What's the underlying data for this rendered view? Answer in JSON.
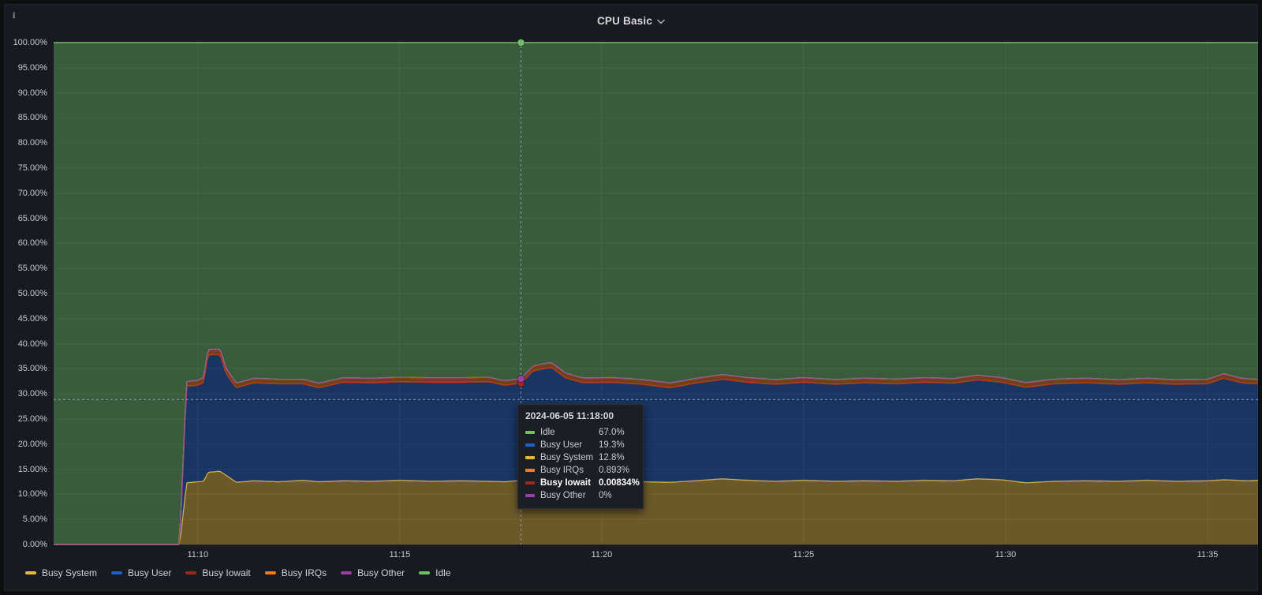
{
  "panel": {
    "title": "CPU Basic",
    "info_icon": "i"
  },
  "y_axis": {
    "ticks": [
      "100.00%",
      "95.00%",
      "90.00%",
      "85.00%",
      "80.00%",
      "75.00%",
      "70.00%",
      "65.00%",
      "60.00%",
      "55.00%",
      "50.00%",
      "45.00%",
      "40.00%",
      "35.00%",
      "30.00%",
      "25.00%",
      "20.00%",
      "15.00%",
      "10.00%",
      "5.00%",
      "0.00%"
    ]
  },
  "x_axis": {
    "ticks": [
      {
        "label": "11:10",
        "t": 10
      },
      {
        "label": "11:15",
        "t": 15
      },
      {
        "label": "11:20",
        "t": 20
      },
      {
        "label": "11:25",
        "t": 25
      },
      {
        "label": "11:30",
        "t": 30
      },
      {
        "label": "11:35",
        "t": 35
      }
    ]
  },
  "legend": {
    "items": [
      {
        "label": "Busy System",
        "color": "#EAB839"
      },
      {
        "label": "Busy User",
        "color": "#1F60C4"
      },
      {
        "label": "Busy Iowait",
        "color": "#A2271A"
      },
      {
        "label": "Busy IRQs",
        "color": "#FF780A"
      },
      {
        "label": "Busy Other",
        "color": "#9A3FA5"
      },
      {
        "label": "Idle",
        "color": "#73BF69"
      }
    ]
  },
  "tooltip": {
    "timestamp": "2024-06-05 11:18:00",
    "rows": [
      {
        "label": "Idle",
        "value": "67.0%",
        "color": "#73BF69",
        "bold": false
      },
      {
        "label": "Busy User",
        "value": "19.3%",
        "color": "#1F60C4",
        "bold": false
      },
      {
        "label": "Busy System",
        "value": "12.8%",
        "color": "#EAB839",
        "bold": false
      },
      {
        "label": "Busy IRQs",
        "value": "0.893%",
        "color": "#FF780A",
        "bold": false
      },
      {
        "label": "Busy Iowait",
        "value": "0.00834%",
        "color": "#A2271A",
        "bold": true
      },
      {
        "label": "Busy Other",
        "value": "0%",
        "color": "#9A3FA5",
        "bold": false
      }
    ]
  },
  "chart_data": {
    "type": "area",
    "stacked": true,
    "title": "CPU Basic",
    "ylabel": "percent",
    "ylim": [
      0,
      100
    ],
    "x_unit": "minutes-after-11:00",
    "x_domain": [
      6.43,
      36.25
    ],
    "grid": true,
    "legend_position": "bottom-left",
    "crosshair": {
      "t": 18,
      "y_percent": 28.9
    },
    "hover_t": 18,
    "fill_opacity": 0.4,
    "series": [
      {
        "name": "Busy System",
        "color": "#EAB839",
        "points": [
          [
            6.43,
            0
          ],
          [
            9.55,
            0
          ],
          [
            9.72,
            12.3
          ],
          [
            10.0,
            12.5
          ],
          [
            10.15,
            12.6
          ],
          [
            10.25,
            14.4
          ],
          [
            10.55,
            14.6
          ],
          [
            10.7,
            13.8
          ],
          [
            10.95,
            12.4
          ],
          [
            11.4,
            12.7
          ],
          [
            12.0,
            12.5
          ],
          [
            12.6,
            12.8
          ],
          [
            13.0,
            12.5
          ],
          [
            13.6,
            12.7
          ],
          [
            14.3,
            12.6
          ],
          [
            15.0,
            12.8
          ],
          [
            15.8,
            12.6
          ],
          [
            16.5,
            12.7
          ],
          [
            17.2,
            12.6
          ],
          [
            17.6,
            12.5
          ],
          [
            18,
            12.8
          ],
          [
            18.5,
            13.0
          ],
          [
            19.1,
            12.9
          ],
          [
            19.6,
            12.6
          ],
          [
            20.3,
            12.7
          ],
          [
            21.0,
            12.5
          ],
          [
            21.7,
            12.4
          ],
          [
            22.3,
            12.7
          ],
          [
            23.0,
            13.1
          ],
          [
            23.6,
            12.8
          ],
          [
            24.3,
            12.6
          ],
          [
            25.0,
            12.8
          ],
          [
            25.8,
            12.6
          ],
          [
            26.5,
            12.7
          ],
          [
            27.3,
            12.6
          ],
          [
            28.0,
            12.8
          ],
          [
            28.7,
            12.7
          ],
          [
            29.3,
            13.1
          ],
          [
            29.9,
            12.9
          ],
          [
            30.5,
            12.3
          ],
          [
            31.2,
            12.6
          ],
          [
            32.0,
            12.7
          ],
          [
            32.8,
            12.6
          ],
          [
            33.5,
            12.8
          ],
          [
            34.2,
            12.6
          ],
          [
            35.0,
            12.7
          ],
          [
            35.4,
            12.9
          ],
          [
            36.0,
            12.7
          ],
          [
            36.25,
            12.8
          ]
        ]
      },
      {
        "name": "Busy User",
        "color": "#1F60C4",
        "points": [
          [
            6.43,
            0
          ],
          [
            9.55,
            0
          ],
          [
            9.72,
            19.2
          ],
          [
            10.0,
            19.2
          ],
          [
            10.15,
            19.7
          ],
          [
            10.25,
            23.4
          ],
          [
            10.55,
            23.2
          ],
          [
            10.7,
            20.2
          ],
          [
            10.95,
            18.8
          ],
          [
            11.4,
            19.5
          ],
          [
            12.0,
            19.5
          ],
          [
            12.6,
            19.2
          ],
          [
            13.0,
            18.7
          ],
          [
            13.6,
            19.6
          ],
          [
            14.3,
            19.6
          ],
          [
            15.0,
            19.6
          ],
          [
            15.8,
            19.7
          ],
          [
            16.5,
            19.6
          ],
          [
            17.2,
            19.8
          ],
          [
            17.6,
            19.2
          ],
          [
            18,
            19.3
          ],
          [
            18.3,
            21.6
          ],
          [
            18.75,
            22.3
          ],
          [
            19.1,
            20.3
          ],
          [
            19.5,
            19.6
          ],
          [
            20.2,
            19.6
          ],
          [
            21.0,
            19.4
          ],
          [
            21.7,
            18.8
          ],
          [
            22.3,
            19.4
          ],
          [
            23.0,
            19.8
          ],
          [
            23.6,
            19.5
          ],
          [
            24.3,
            19.3
          ],
          [
            25.0,
            19.5
          ],
          [
            25.8,
            19.3
          ],
          [
            26.5,
            19.5
          ],
          [
            27.3,
            19.4
          ],
          [
            28.0,
            19.5
          ],
          [
            28.7,
            19.4
          ],
          [
            29.3,
            19.7
          ],
          [
            29.9,
            19.4
          ],
          [
            30.5,
            19.0
          ],
          [
            31.2,
            19.4
          ],
          [
            32.0,
            19.5
          ],
          [
            32.8,
            19.3
          ],
          [
            33.5,
            19.4
          ],
          [
            34.2,
            19.3
          ],
          [
            35.0,
            19.3
          ],
          [
            35.4,
            20.2
          ],
          [
            35.8,
            19.5
          ],
          [
            36.25,
            19.2
          ]
        ]
      },
      {
        "name": "Busy Iowait",
        "color": "#A2271A",
        "points": [
          [
            6.43,
            0
          ],
          [
            9.55,
            0
          ],
          [
            9.72,
            0.01
          ],
          [
            36.25,
            0.01
          ]
        ]
      },
      {
        "name": "Busy IRQs",
        "color": "#FF780A",
        "points": [
          [
            6.43,
            0
          ],
          [
            9.55,
            0
          ],
          [
            9.72,
            0.9
          ],
          [
            10.15,
            1.0
          ],
          [
            10.6,
            1.1
          ],
          [
            11.0,
            0.9
          ],
          [
            17.9,
            0.9
          ],
          [
            18,
            0.893
          ],
          [
            18.4,
            1.0
          ],
          [
            19.0,
            0.95
          ],
          [
            36.25,
            0.9
          ]
        ]
      },
      {
        "name": "Busy Other",
        "color": "#9A3FA5",
        "points": [
          [
            6.43,
            0
          ],
          [
            36.25,
            0
          ]
        ]
      },
      {
        "name": "Idle",
        "color": "#73BF69",
        "remainder_to": 100
      }
    ]
  },
  "colors": {
    "panel_bg": "#171a21",
    "page_bg": "#0e0f13",
    "grid": "rgba(204,210,224,0.07)",
    "crosshair": "rgba(173,186,204,0.75)",
    "axis_text": "#c7c9d1"
  }
}
